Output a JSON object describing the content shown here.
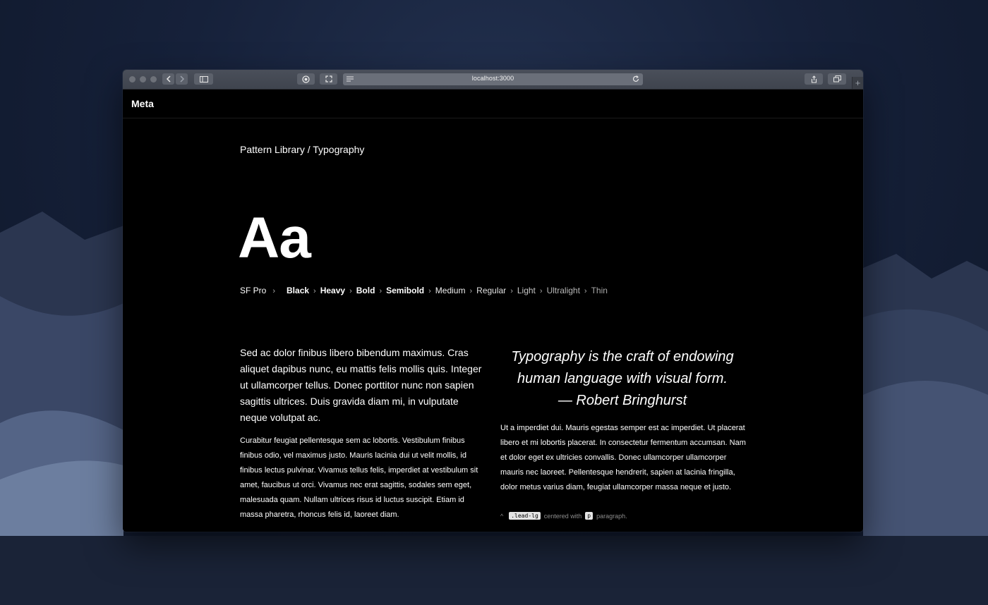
{
  "browser": {
    "url": "localhost:3000"
  },
  "site": {
    "brand": "Meta"
  },
  "page": {
    "breadcrumb": "Pattern Library / Typography",
    "specimen": "Aa",
    "font_family": "SF Pro",
    "separator": "›",
    "weights": [
      "Black",
      "Heavy",
      "Bold",
      "Semibold",
      "Medium",
      "Regular",
      "Light",
      "Ultralight",
      "Thin"
    ],
    "lead_paragraph": "Sed ac dolor finibus libero bibendum maximus. Cras aliquet dapibus nunc, eu mattis felis mollis quis. Integer ut ullamcorper tellus. Donec porttitor nunc non sapien sagittis ultrices. Duis gravida diam mi, in vulputate neque volutpat ac.",
    "body_left": "Curabitur feugiat pellentesque sem ac lobortis. Vestibulum finibus finibus odio, vel maximus justo. Mauris lacinia dui ut velit mollis, id finibus lectus pulvinar. Vivamus tellus felis, imperdiet at vestibulum sit amet, faucibus ut orci. Vivamus nec erat sagittis, sodales sem eget, malesuada quam. Nullam ultrices risus id luctus suscipit. Etiam id massa pharetra, rhoncus felis id, laoreet diam.",
    "quote_line1": "Typography is the craft of endowing",
    "quote_line2": "human language with visual form.",
    "quote_author": "— Robert Bringhurst",
    "body_right": "Ut a imperdiet dui. Mauris egestas semper est ac imperdiet. Ut placerat libero et mi lobortis placerat. In consectetur fermentum accumsan. Nam et dolor eget ex ultricies convallis. Donec ullamcorper ullamcorper mauris nec laoreet. Pellentesque hendrerit, sapien at lacinia fringilla, dolor metus varius diam, feugiat ullamcorper massa neque et justo.",
    "note": {
      "caret": "^",
      "class_code": ".lead-lg",
      "text1": "centered with",
      "tag_code": "p",
      "text2": "paragraph."
    }
  }
}
